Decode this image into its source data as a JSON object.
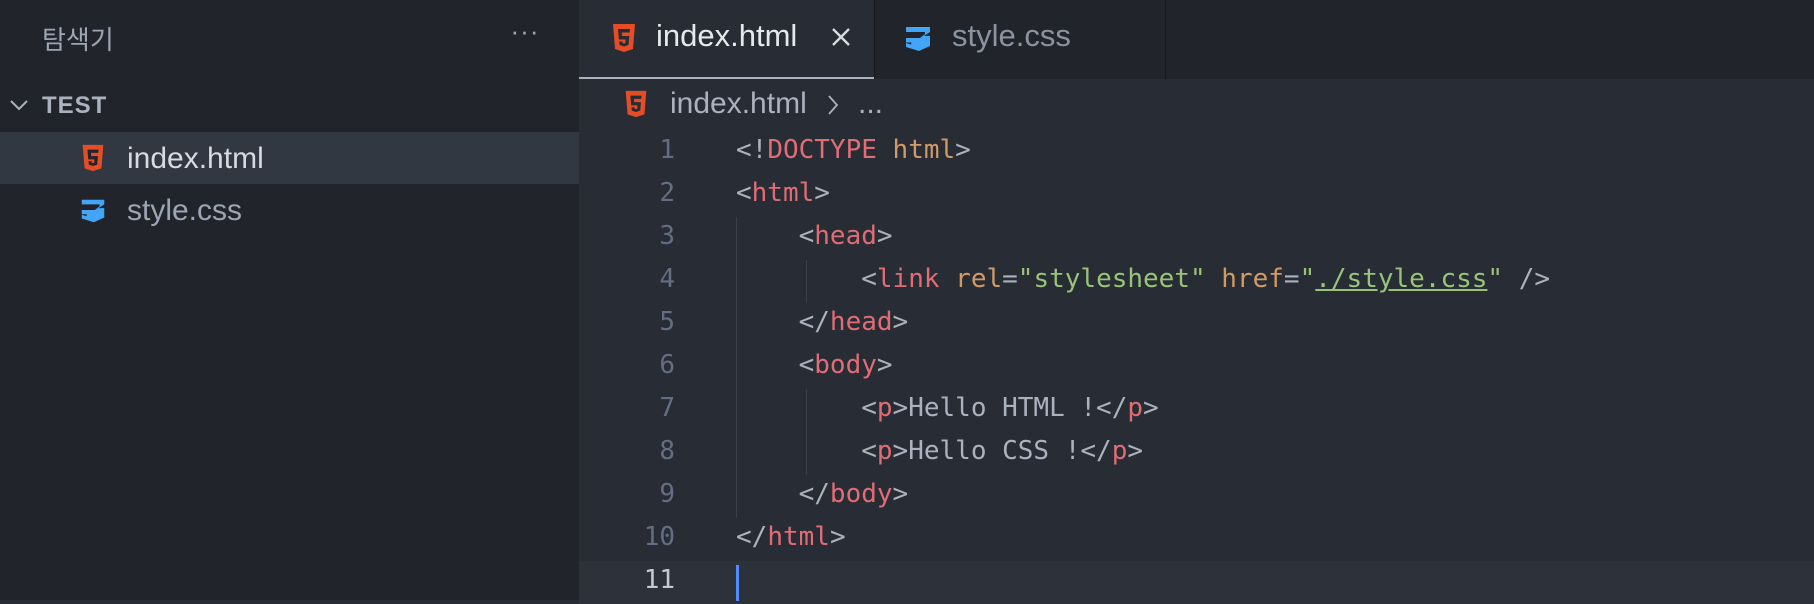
{
  "sidebar": {
    "title": "탐색기",
    "more_label": "···",
    "folder": {
      "label": "TEST"
    },
    "files": [
      {
        "label": "index.html",
        "icon": "html5-icon",
        "active": true
      },
      {
        "label": "style.css",
        "icon": "css3-icon",
        "active": false
      }
    ]
  },
  "tabs": [
    {
      "label": "index.html",
      "icon": "html5-icon",
      "active": true
    },
    {
      "label": "style.css",
      "icon": "css3-icon",
      "active": false
    }
  ],
  "breadcrumb": {
    "file": "index.html",
    "more": "..."
  },
  "editor": {
    "current_line": 11,
    "lines": [
      {
        "n": "1",
        "tokens": [
          [
            "p",
            "<!"
          ],
          [
            "doc",
            "DOCTYPE"
          ],
          [
            "p",
            " "
          ],
          [
            "dochtml",
            "html"
          ],
          [
            "p",
            ">"
          ]
        ]
      },
      {
        "n": "2",
        "tokens": [
          [
            "p",
            "<"
          ],
          [
            "tag",
            "html"
          ],
          [
            "p",
            ">"
          ]
        ]
      },
      {
        "n": "3",
        "tokens": [
          [
            "p",
            "    <"
          ],
          [
            "tag",
            "head"
          ],
          [
            "p",
            ">"
          ]
        ]
      },
      {
        "n": "4",
        "tokens": [
          [
            "p",
            "        <"
          ],
          [
            "tag",
            "link"
          ],
          [
            "p",
            " "
          ],
          [
            "attr",
            "rel"
          ],
          [
            "p",
            "="
          ],
          [
            "str",
            "\"stylesheet\""
          ],
          [
            "p",
            " "
          ],
          [
            "attr",
            "href"
          ],
          [
            "p",
            "="
          ],
          [
            "str",
            "\""
          ],
          [
            "link",
            "./style.css"
          ],
          [
            "str",
            "\""
          ],
          [
            "p",
            " />"
          ]
        ]
      },
      {
        "n": "5",
        "tokens": [
          [
            "p",
            "    </"
          ],
          [
            "tag",
            "head"
          ],
          [
            "p",
            ">"
          ]
        ]
      },
      {
        "n": "6",
        "tokens": [
          [
            "p",
            "    <"
          ],
          [
            "tag",
            "body"
          ],
          [
            "p",
            ">"
          ]
        ]
      },
      {
        "n": "7",
        "tokens": [
          [
            "p",
            "        <"
          ],
          [
            "tag",
            "p"
          ],
          [
            "p",
            ">Hello HTML !</"
          ],
          [
            "tag",
            "p"
          ],
          [
            "p",
            ">"
          ]
        ]
      },
      {
        "n": "8",
        "tokens": [
          [
            "p",
            "        <"
          ],
          [
            "tag",
            "p"
          ],
          [
            "p",
            ">Hello CSS !</"
          ],
          [
            "tag",
            "p"
          ],
          [
            "p",
            ">"
          ]
        ]
      },
      {
        "n": "9",
        "tokens": [
          [
            "p",
            "    </"
          ],
          [
            "tag",
            "body"
          ],
          [
            "p",
            ">"
          ]
        ]
      },
      {
        "n": "10",
        "tokens": [
          [
            "p",
            "</"
          ],
          [
            "tag",
            "html"
          ],
          [
            "p",
            ">"
          ]
        ]
      },
      {
        "n": "11",
        "tokens": []
      }
    ]
  },
  "colors": {
    "html_icon": "#e44d26",
    "css_icon": "#42a5f5",
    "cursor": "#528bff"
  }
}
